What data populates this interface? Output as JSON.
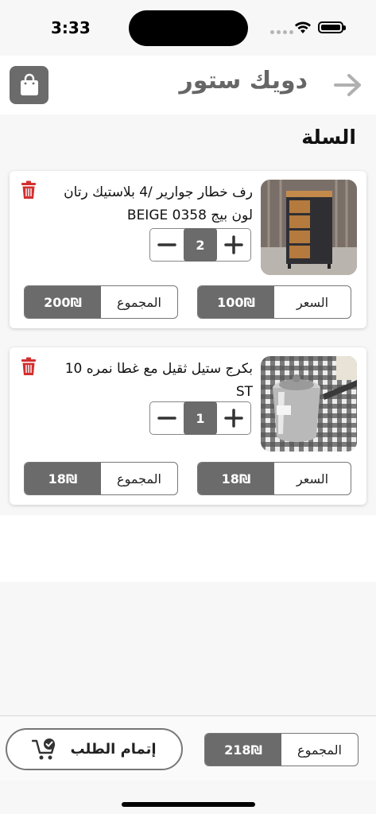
{
  "status_bar": {
    "time": "3:33"
  },
  "header": {
    "title": "دويك ستور",
    "cart_icon": "shopping-bag-icon",
    "back_icon": "arrow-right-icon"
  },
  "cart": {
    "title": "السلة",
    "items": [
      {
        "name": "رف خطار جوارير /4 بلاستيك رتان لون بيج BEIGE 0358",
        "quantity": "2",
        "price_label": "السعر",
        "price": "100₪",
        "total_label": "المجموع",
        "total": "200₪"
      },
      {
        "name": "بكرج ستيل ثقيل مع غطا نمره 10 ST",
        "quantity": "1",
        "price_label": "السعر",
        "price": "18₪",
        "total_label": "المجموع",
        "total": "18₪"
      }
    ]
  },
  "footer": {
    "total_label": "المجموع",
    "total": "218₪",
    "checkout_label": "إتمام الطلب"
  },
  "colors": {
    "accent": "#6b6b6b",
    "delete": "#d32f2f",
    "arrow": "#b0b0b0"
  }
}
